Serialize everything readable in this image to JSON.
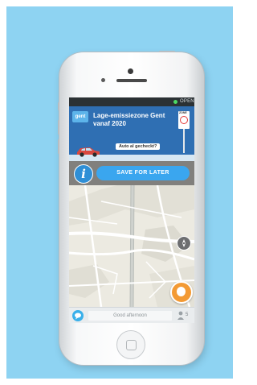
{
  "status_bar": {
    "open_label": "OPEN"
  },
  "banner": {
    "logo_text": "gent",
    "title": "Lage-emissiezone Gent vanaf 2020",
    "bubble_text": "Auto al gecheckt?",
    "sign_text": "ZONE"
  },
  "actions": {
    "info_label": "i",
    "save_label": "SAVE FOR LATER"
  },
  "bottom_bar": {
    "greeting_placeholder": "Good afternoon",
    "people_count": "5"
  },
  "icons": {
    "chat": "chat-bubble-icon",
    "people": "people-icon",
    "compass": "compass-icon",
    "report": "report-icon"
  },
  "colors": {
    "background": "#8ed3f2",
    "accent": "#3aa6ef",
    "report": "#f39a34",
    "status_open": "#4cd964",
    "banner": "#2f6fb3"
  }
}
